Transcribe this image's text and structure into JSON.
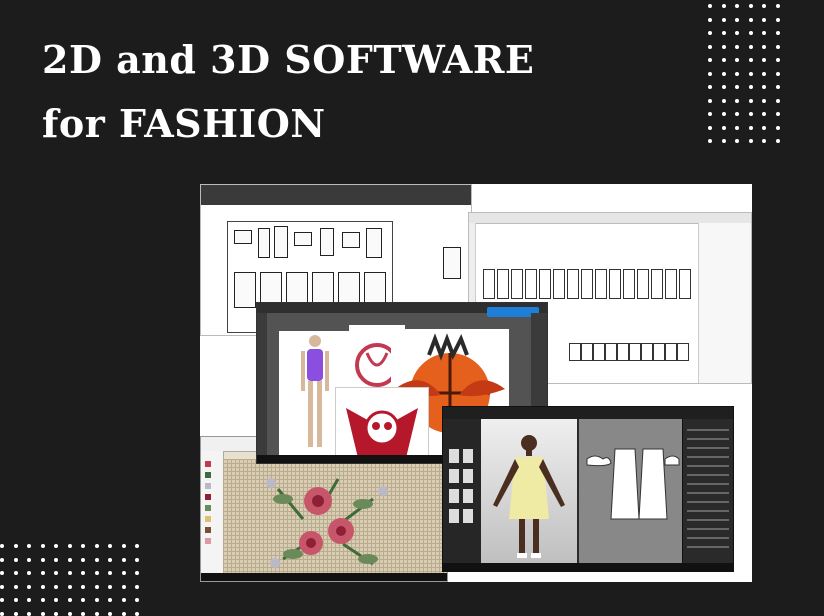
{
  "headline": {
    "line1": "2D and 3D SOFTWARE",
    "line2": "for FASHION"
  },
  "collage": {
    "windows": [
      {
        "id": "cad",
        "icon": "pattern-cad-icon"
      },
      {
        "id": "corel",
        "icon": "vector-drawing-icon"
      },
      {
        "id": "illustrator",
        "icon": "graphic-design-icon"
      },
      {
        "id": "embroidery",
        "icon": "cross-stitch-icon"
      },
      {
        "id": "3d",
        "icon": "3d-garment-icon"
      }
    ]
  },
  "colors": {
    "background": "#1c1c1c",
    "text": "#ffffff",
    "accent_purple": "#8a4fe0",
    "accent_orange": "#e4601c",
    "accent_red": "#b5182a",
    "dress_yellow": "#efeaa4",
    "notice_blue": "#1e7fd8"
  }
}
